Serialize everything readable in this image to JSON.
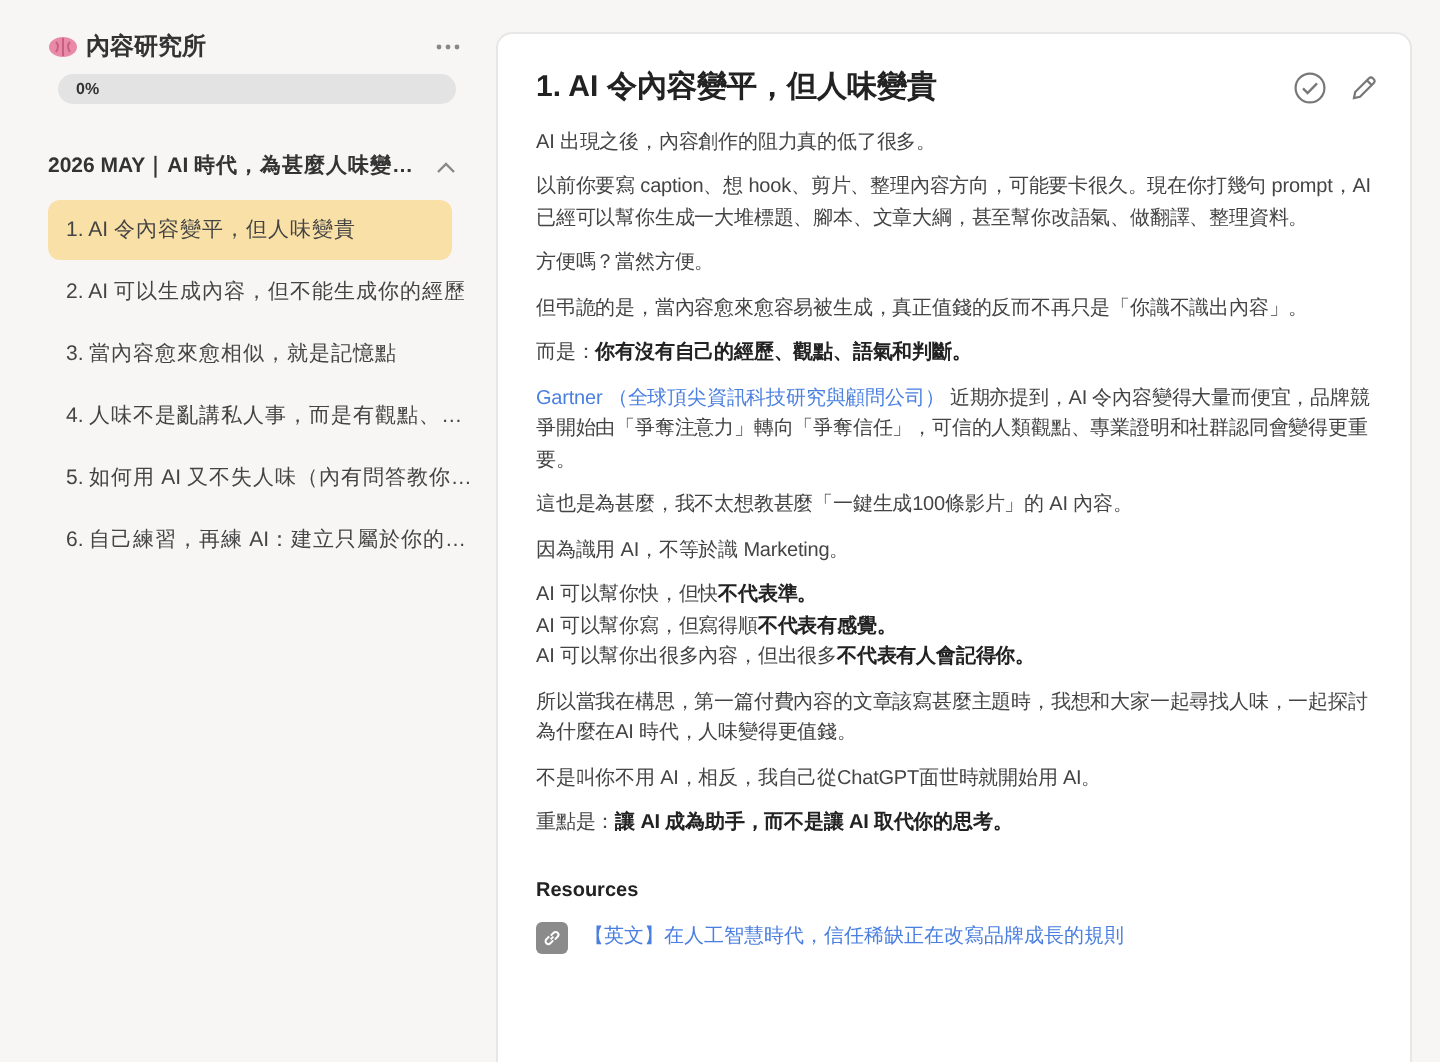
{
  "sidebar": {
    "title": "內容研究所",
    "progress": {
      "level": 0,
      "label": "0%"
    },
    "section": {
      "title": "2026 MAY｜AI 時代，為甚麼人味變…",
      "expanded": true
    },
    "items": [
      {
        "label": "1. AI 令內容變平，但人味變貴",
        "selected": true
      },
      {
        "label": "2. AI 可以生成內容，但不能生成你的經歷",
        "selected": false
      },
      {
        "label": "3. 當內容愈來愈相似，就是記憶點",
        "selected": false
      },
      {
        "label": "4. 人味不是亂講私人事，而是有觀點、…",
        "selected": false
      },
      {
        "label": "5. 如何用 AI 又不失人味（內有問答教你…",
        "selected": false
      },
      {
        "label": "6. 自己練習，再練 AI：建立只屬於你的…",
        "selected": false
      }
    ]
  },
  "article": {
    "title": "1. AI 令內容變平，但人味變貴",
    "completed": false,
    "paragraphs": [
      {
        "kind": "text",
        "text": "AI 出現之後，內容創作的阻力真的低了很多。"
      },
      {
        "kind": "text",
        "text": "以前你要寫 caption、想 hook、剪片、整理內容方向，可能要卡很久。現在你打幾句 prompt，AI 已經可以幫你生成一大堆標題、腳本、文章大綱，甚至幫你改語氣、做翻譯、整理資料。"
      },
      {
        "kind": "text",
        "text": "方便嗎？當然方便。"
      },
      {
        "kind": "text",
        "text": "但弔詭的是，當內容愈來愈容易被生成，真正值錢的反而不再只是「你識不識出內容」。"
      },
      {
        "kind": "text",
        "text": "而是：**你有沒有自己的經歷、觀點、語氣和判斷。**"
      },
      {
        "kind": "link",
        "link": "Gartner （全球頂尖資訊科技研究與顧問公司）",
        "text": " 近期亦提到，AI 令內容變得大量而便宜，品牌競爭開始由「爭奪注意力」轉向「爭奪信任」，可信的人類觀點、專業證明和社群認同會變得更重要。"
      },
      {
        "kind": "text",
        "text": "這也是為甚麼，我不太想教甚麼「一鍵生成100條影片」的 AI 內容。"
      },
      {
        "kind": "text",
        "text": "因為識用 AI，不等於識 Marketing。"
      },
      {
        "kind": "lines",
        "lines": [
          "AI 可以幫你快，但快**不代表準。**",
          "AI 可以幫你寫，但寫得順**不代表有感覺。**",
          "AI 可以幫你出很多內容，但出很多**不代表有人會記得你。**"
        ]
      },
      {
        "kind": "text",
        "text": "所以當我在構思，第一篇付費內容的文章該寫甚麼主題時，我想和大家一起尋找人味，一起探討為什麼在AI 時代，人味變得更值錢。"
      },
      {
        "kind": "text",
        "text": "不是叫你不用 AI，相反，我自己從ChatGPT面世時就開始用 AI。"
      },
      {
        "kind": "text",
        "text": "重點是：**讓 AI 成為助手，而不是讓 AI 取代你的思考。**"
      }
    ],
    "resources_heading": "Resources",
    "resources": [
      {
        "label": "【英文】在人工智慧時代，信任稀缺正在改寫品牌成長的規則"
      }
    ]
  }
}
